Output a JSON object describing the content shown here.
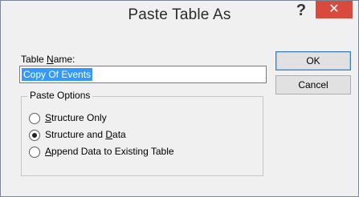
{
  "window": {
    "title": "Paste Table As",
    "help_glyph": "?",
    "close_glyph": "✕"
  },
  "form": {
    "table_name_label_pre": "Table ",
    "table_name_label_key": "N",
    "table_name_label_post": "ame:",
    "table_name_value": "Copy Of Events"
  },
  "buttons": {
    "ok": "OK",
    "cancel": "Cancel"
  },
  "paste_options": {
    "legend": "Paste Options",
    "options": [
      {
        "pre": "",
        "key": "S",
        "post": "tructure Only",
        "selected": false
      },
      {
        "pre": "Structure and ",
        "key": "D",
        "post": "ata",
        "selected": true
      },
      {
        "pre": "",
        "key": "A",
        "post": "ppend Data to Existing Table",
        "selected": false
      }
    ]
  },
  "colors": {
    "close_button": "#d84a3d",
    "selection": "#3399ff"
  }
}
